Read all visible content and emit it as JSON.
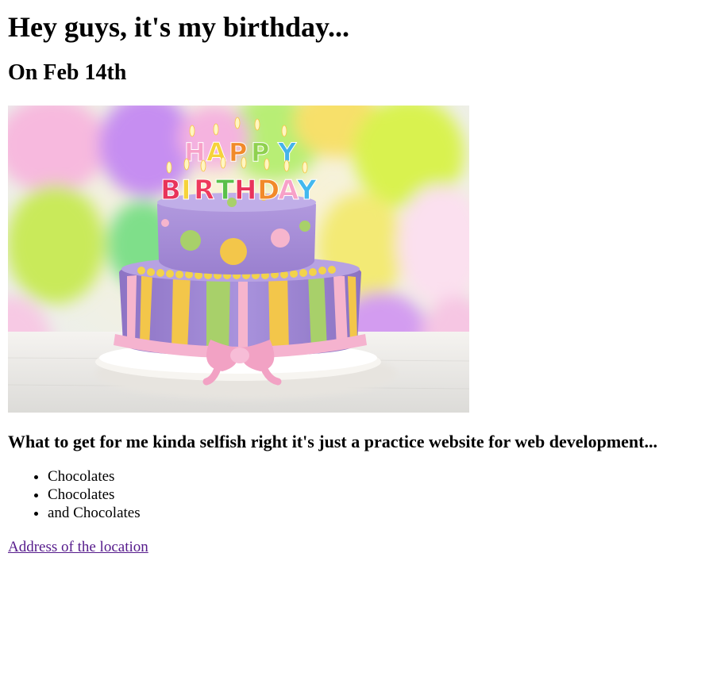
{
  "page": {
    "title": "Hey guys, it's my birthday...",
    "date_heading": "On Feb 14th",
    "hero_image": {
      "candle_text_top": "HAPPY",
      "candle_text_bottom": "BIRTHDAY",
      "candle_colors": [
        "#f6d33a",
        "#43b8ee",
        "#e8335b",
        "#f7a1c8",
        "#5ac04a",
        "#f18a2a",
        "#ee3a5c",
        "#8fd14f",
        "#45b3e9"
      ],
      "cake_colors": {
        "top_tier": "#a58fd6",
        "bottom_tier": "#9c83d4",
        "stripe_green": "#a8d06a",
        "stripe_yellow": "#f3c64a",
        "stripe_pink": "#f6b5cd",
        "pearls": "#f2d34a",
        "ribbon": "#f5b3cf",
        "plate": "#f4f1ec"
      },
      "balloon_colors": [
        "#f4a9d8",
        "#bfe44c",
        "#d6ef4f",
        "#f5ea63",
        "#c98ff0",
        "#fcd8e8",
        "#7fdd7c"
      ]
    },
    "wishlist_heading": "What to get for me kinda selfish right it's just a practice website for web development...",
    "wishlist": [
      "Chocolates",
      "Chocolates",
      "and Chocolates"
    ],
    "location_link": "Address of the location"
  }
}
